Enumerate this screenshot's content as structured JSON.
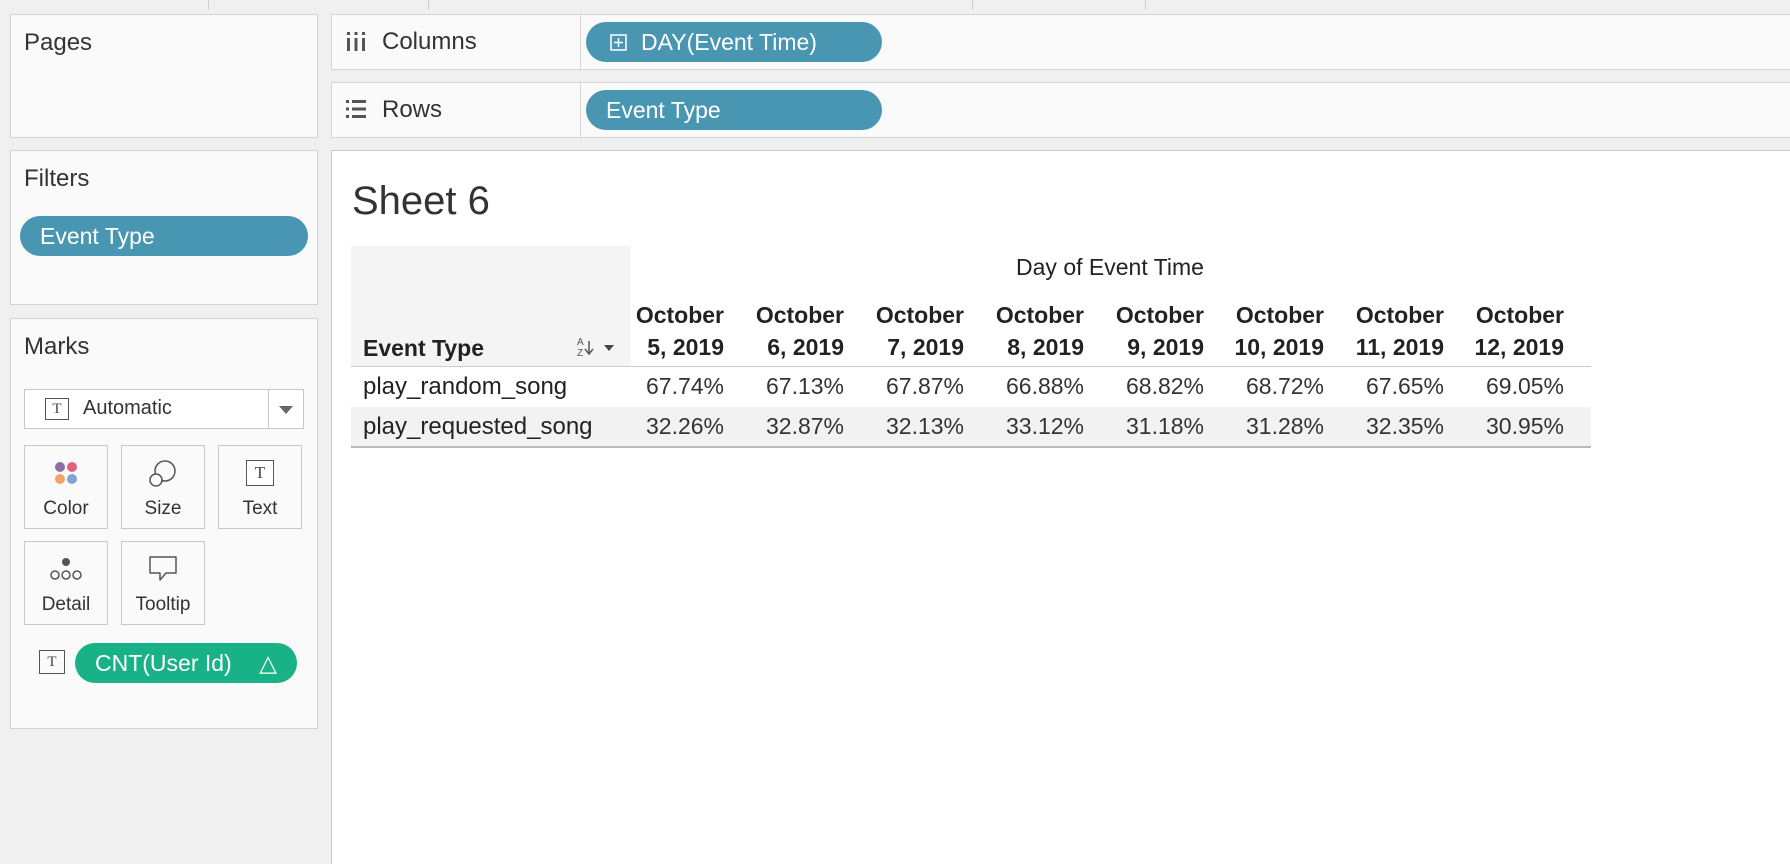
{
  "panels": {
    "pages": {
      "title": "Pages"
    },
    "filters": {
      "title": "Filters",
      "pill": "Event Type"
    },
    "marks": {
      "title": "Marks",
      "mark_type": "Automatic",
      "buttons": {
        "color": "Color",
        "size": "Size",
        "text": "Text",
        "detail": "Detail",
        "tooltip": "Tooltip"
      },
      "text_pill": "CNT(User Id)",
      "text_pill_badge": "△"
    }
  },
  "shelves": {
    "columns": {
      "label": "Columns",
      "pill": "DAY(Event Time)"
    },
    "rows": {
      "label": "Rows",
      "pill": "Event Type"
    }
  },
  "sheet": {
    "title": "Sheet 6",
    "column_group_title": "Day of Event Time",
    "row_header": "Event Type",
    "columns": [
      {
        "line1": "October",
        "line2": "5, 2019"
      },
      {
        "line1": "October",
        "line2": "6, 2019"
      },
      {
        "line1": "October",
        "line2": "7, 2019"
      },
      {
        "line1": "October",
        "line2": "8, 2019"
      },
      {
        "line1": "October",
        "line2": "9, 2019"
      },
      {
        "line1": "October",
        "line2": "10, 2019"
      },
      {
        "line1": "October",
        "line2": "11, 2019"
      },
      {
        "line1": "October",
        "line2": "12, 2019"
      }
    ],
    "rows": [
      {
        "label": "play_random_song",
        "values": [
          "67.74%",
          "67.13%",
          "67.87%",
          "66.88%",
          "68.82%",
          "68.72%",
          "67.65%",
          "69.05%"
        ]
      },
      {
        "label": "play_requested_song",
        "values": [
          "32.26%",
          "32.87%",
          "32.13%",
          "33.12%",
          "31.18%",
          "31.28%",
          "32.35%",
          "30.95%"
        ]
      }
    ]
  },
  "colors": {
    "dimension_pill": "#4996b2",
    "measure_pill": "#19b286"
  },
  "icons": {
    "columns": "columns-icon",
    "rows": "rows-icon",
    "date_expand": "plus-box-icon",
    "text_mark": "text-box-icon",
    "sort": "sort-alpha-icon",
    "dropdown": "caret-down-icon"
  }
}
